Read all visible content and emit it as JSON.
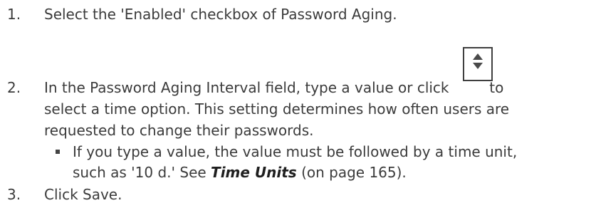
{
  "steps": [
    {
      "number": "1.",
      "text": "Select the 'Enabled' checkbox of Password Aging."
    },
    {
      "number": "2.",
      "line1_before_icon": "In the Password Aging Interval field, type a value or click",
      "line1_after_icon": "to",
      "line2": "select a time option. This setting determines how often users are",
      "line3": "requested to change their passwords.",
      "icon": "spinner-up-down-icon",
      "bullet": {
        "line1": "If you type a value, the value must be followed by a time unit,",
        "line2_before_link": "such as '10 d.' See",
        "link_text": "Time Units",
        "line2_after_link": "(on page 165)."
      }
    },
    {
      "number": "3.",
      "text": "Click Save."
    }
  ]
}
